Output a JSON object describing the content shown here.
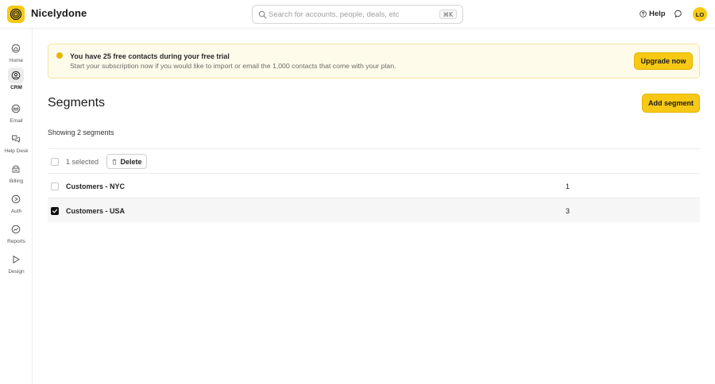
{
  "app": {
    "name": "Nicelydone"
  },
  "search": {
    "placeholder": "Search for accounts, people, deals, etc",
    "shortcut": "⌘K"
  },
  "header": {
    "help_label": "Help",
    "avatar_initials": "LO"
  },
  "sidebar": {
    "items": [
      {
        "label": "Home",
        "icon": "home-icon",
        "active": false
      },
      {
        "label": "CRM",
        "icon": "crm-icon",
        "active": true
      },
      {
        "label": "Email",
        "icon": "email-icon",
        "active": false
      },
      {
        "label": "Help Desk",
        "icon": "help-desk-icon",
        "active": false
      },
      {
        "label": "Billing",
        "icon": "billing-icon",
        "active": false
      },
      {
        "label": "Auth",
        "icon": "auth-icon",
        "active": false
      },
      {
        "label": "Reports",
        "icon": "reports-icon",
        "active": false
      },
      {
        "label": "Design",
        "icon": "design-icon",
        "active": false
      }
    ]
  },
  "banner": {
    "title": "You have 25 free contacts during your free trial",
    "text": "Start your subscription now if you would like to import or email the 1,000 contacts that come with your plan.",
    "button_label": "Upgrade now"
  },
  "page": {
    "title": "Segments",
    "add_button_label": "Add segment",
    "showing_text": "Showing 2 segments"
  },
  "table": {
    "selected_text": "1 selected",
    "delete_label": "Delete",
    "rows": [
      {
        "name": "Customers - NYC",
        "count": "1",
        "checked": false
      },
      {
        "name": "Customers - USA",
        "count": "3",
        "checked": true
      }
    ]
  },
  "colors": {
    "accent": "#f7c915",
    "banner_bg": "#fffbeb",
    "selected_row": "#f6f6f6"
  }
}
